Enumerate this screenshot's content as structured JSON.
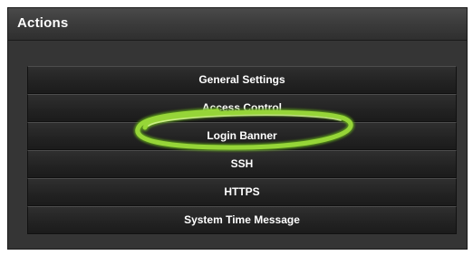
{
  "panel": {
    "title": "Actions"
  },
  "menu": {
    "items": [
      {
        "label": "General Settings"
      },
      {
        "label": "Access Control"
      },
      {
        "label": "Login Banner"
      },
      {
        "label": "SSH"
      },
      {
        "label": "HTTPS"
      },
      {
        "label": "System Time Message"
      }
    ]
  },
  "colors": {
    "highlight": "#8fd135",
    "panel_bg": "#353535",
    "button_bg": "#222222"
  },
  "annotation": {
    "highlighted_item": "Login Banner",
    "shape": "green-ellipse-marker"
  }
}
